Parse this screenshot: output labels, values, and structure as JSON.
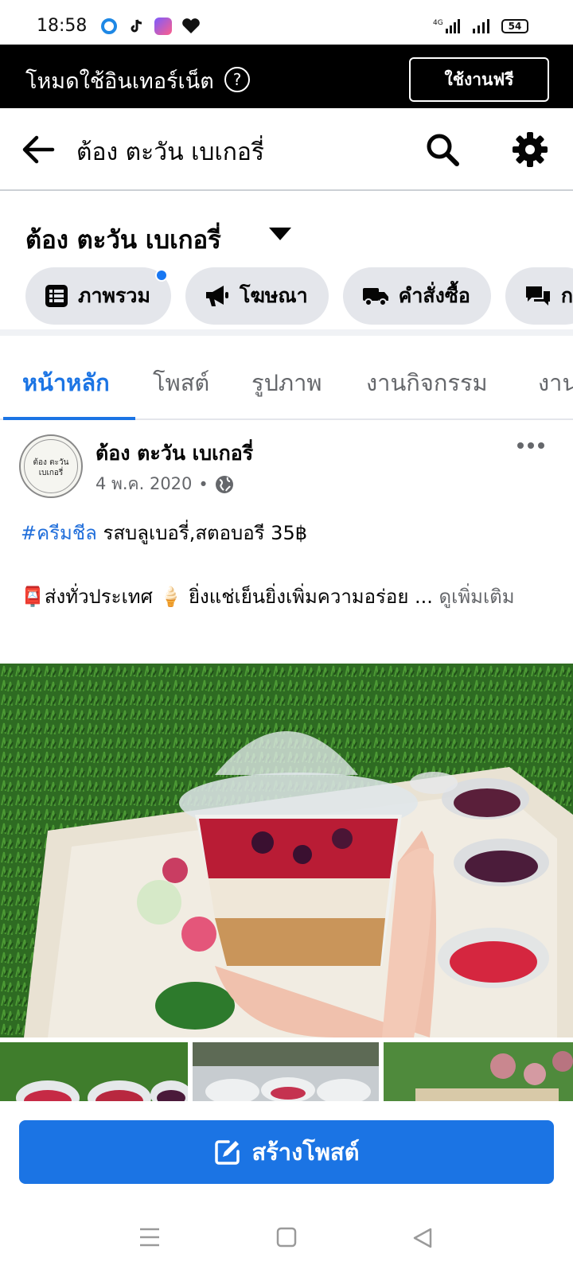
{
  "status_bar": {
    "time": "18:58",
    "network": "4G",
    "battery": "54"
  },
  "banner": {
    "text": "โหมดใช้อินเทอร์เน็ต",
    "help_symbol": "?",
    "button_label": "ใช้งานฟรี"
  },
  "app_bar": {
    "title": "ต้อง ตะวัน เบเกอรี่"
  },
  "page_header": {
    "name": "ต้อง ตะวัน เบเกอรี่",
    "chips": [
      {
        "label": "ภาพรวม",
        "icon": "list-icon"
      },
      {
        "label": "โฆษณา",
        "icon": "megaphone-icon"
      },
      {
        "label": "คำสั่งซื้อ",
        "icon": "truck-icon"
      },
      {
        "label": "ก",
        "icon": "chat-bubbles-icon"
      }
    ]
  },
  "tabs": [
    "หน้าหลัก",
    "โพสต์",
    "รูปภาพ",
    "งานกิจกรรม",
    "งาน"
  ],
  "post": {
    "author": "ต้อง ตะวัน เบเกอรี่",
    "avatar_text_line1": "ต้อง ตะวัน",
    "avatar_text_line2": "เบเกอรี่",
    "date": "4 พ.ค. 2020",
    "dot": "•",
    "hashtag": "#ครีมชีล",
    "line1_rest": " รสบลูเบอรี่,สตอบอรี 35฿",
    "line2": "📮ส่งทั่วประเทศ 🍦 ยิ่งแช่เย็นยิ่งเพิ่มความอร่อย ...",
    "see_more": " ดูเพิ่มเติม"
  },
  "create_post": {
    "label": "สร้างโพสต์"
  },
  "colors": {
    "accent": "#1b74e4",
    "chip_bg": "#e4e6eb",
    "banner_bg": "#000000"
  }
}
